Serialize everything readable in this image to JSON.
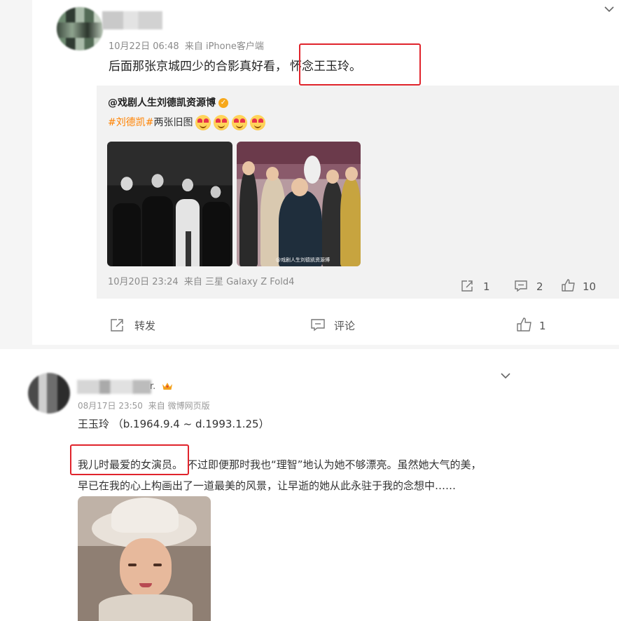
{
  "post1": {
    "timestamp": "10月22日 06:48",
    "source": "来自 iPhone客户端",
    "text_before": "后面那张京城四少的合影真好看，",
    "text_highlight": "怀念王玉玲。",
    "repost": {
      "author": "@戏剧人生刘德凯资源博",
      "hashtag": "#刘德凯#",
      "text": "两张旧图",
      "watermark": "@戏剧人生刘德凯资源博",
      "timestamp": "10月20日 23:24",
      "source": "来自 三星 Galaxy Z Fold4",
      "repost_count": "1",
      "comment_count": "2",
      "like_count": "10"
    },
    "actions": {
      "repost_label": "转发",
      "comment_label": "评论",
      "like_count": "1"
    }
  },
  "post2": {
    "name_suffix": "r.",
    "timestamp": "08月17日 23:50",
    "source": "来自 微博网页版",
    "line1": "王玉玲 （b.1964.9.4 ~ d.1993.1.25）",
    "highlight": "我儿时最爱的女演员。",
    "line2_rest": "不过即便那时我也“理智”地认为她不够漂亮。虽然她大气的美，",
    "line3": "早已在我的心上构画出了一道最美的风景，让早逝的她从此永驻于我的念想中……"
  },
  "colors": {
    "highlight_box": "#e0242c",
    "hashtag": "#ff8200",
    "verified_badge": "#f7a81b"
  }
}
